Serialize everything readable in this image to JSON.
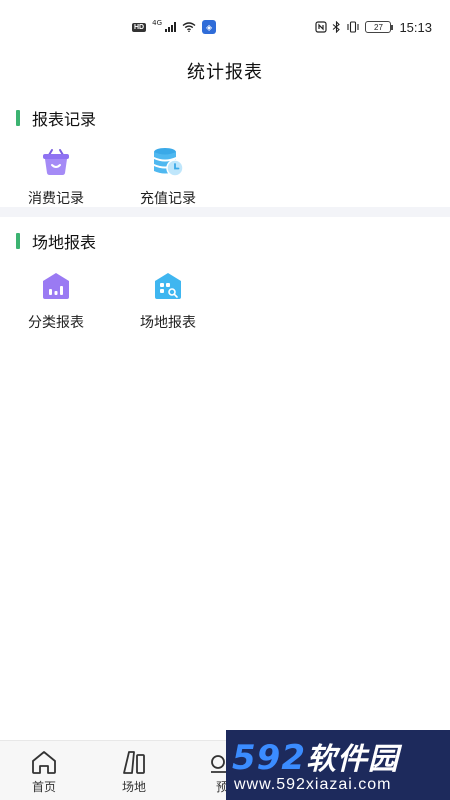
{
  "status_bar": {
    "hd_label": "HD",
    "network_type": "4G",
    "battery_level": "27",
    "time": "15:13"
  },
  "header": {
    "title": "统计报表"
  },
  "sections": [
    {
      "title": "报表记录",
      "items": [
        {
          "label": "消费记录",
          "icon": "basket-icon"
        },
        {
          "label": "充值记录",
          "icon": "database-clock-icon"
        }
      ]
    },
    {
      "title": "场地报表",
      "items": [
        {
          "label": "分类报表",
          "icon": "bar-house-icon"
        },
        {
          "label": "场地报表",
          "icon": "venue-search-icon"
        }
      ]
    }
  ],
  "bottom_nav": [
    {
      "label": "首页",
      "icon": "home-icon"
    },
    {
      "label": "场地",
      "icon": "venue-icon"
    },
    {
      "label": "预",
      "icon": "booking-icon"
    }
  ],
  "watermark": {
    "brand_number": "592",
    "brand_text": "软件园",
    "url": "www.592xiazai.com"
  },
  "colors": {
    "accent_green": "#3cb371",
    "purple": "#8b6cf0",
    "blue": "#3fb6f0"
  }
}
